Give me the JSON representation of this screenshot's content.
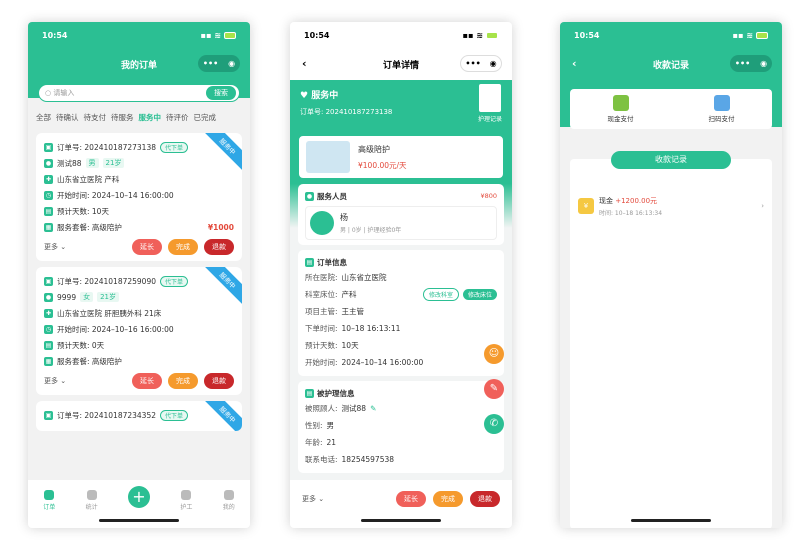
{
  "status_time": "10:54",
  "phone1": {
    "title": "我的订单",
    "search_placeholder": "请输入",
    "search_btn": "搜索",
    "tabs": [
      "全部",
      "待确认",
      "待支付",
      "待服务",
      "服务中",
      "待评价",
      "已完成"
    ],
    "orders": [
      {
        "no": "订单号: 202410187273138",
        "tag": "代下单",
        "ribbon": "服务中",
        "name": "测试88",
        "gender": "男",
        "age": "21岁",
        "hospital": "山东省立医院 产科",
        "start": "开始时间: 2024–10–14 16:00:00",
        "days": "预计天数: 10天",
        "pkg": "服务套餐: 高级陪护",
        "price": "¥1000"
      },
      {
        "no": "订单号: 202410187259090",
        "tag": "代下单",
        "ribbon": "服务中",
        "name": "9999",
        "gender": "女",
        "age": "21岁",
        "hospital": "山东省立医院 肝胆胰外科 21床",
        "start": "开始时间: 2024–10–16 16:00:00",
        "days": "预计天数: 0天",
        "pkg": "服务套餐: 高级陪护",
        "price": ""
      },
      {
        "no": "订单号: 202410187234352",
        "tag": "代下单",
        "ribbon": "服务中"
      }
    ],
    "more": "更多",
    "btn_extend": "延长",
    "btn_done": "完成",
    "btn_refund": "退款",
    "tabbar": [
      "订单",
      "统计",
      "",
      "护工",
      "我的"
    ]
  },
  "phone2": {
    "title": "订单详情",
    "state": "服务中",
    "order_no": "订单号: 202410187273138",
    "care_record": "护理记录",
    "service_name": "高级陪护",
    "service_price": "¥100.00元/天",
    "staff_title": "服务人员",
    "staff_price": "¥800",
    "staff_name": "杨",
    "staff_info": "男 | 0岁 | 护理经验0年",
    "order_info_title": "订单信息",
    "info": [
      {
        "k": "所在医院:",
        "v": "山东省立医院"
      },
      {
        "k": "科室床位:",
        "v": "产科"
      },
      {
        "k": "项目主管:",
        "v": "王主管"
      },
      {
        "k": "下单时间:",
        "v": "10–18 16:13:11"
      },
      {
        "k": "预计天数:",
        "v": "10天"
      },
      {
        "k": "开始时间:",
        "v": "2024–10–14 16:00:00"
      }
    ],
    "edit_dept": "修改科室",
    "edit_bed": "修改床位",
    "patient_title": "被护理信息",
    "patient": [
      {
        "k": "被照顾人:",
        "v": "测试88"
      },
      {
        "k": "性别:",
        "v": "男"
      },
      {
        "k": "年龄:",
        "v": "21"
      },
      {
        "k": "联系电话:",
        "v": "18254597538"
      }
    ],
    "more": "更多",
    "btn_extend": "延长",
    "btn_done": "完成",
    "btn_refund": "退款"
  },
  "phone3": {
    "title": "收款记录",
    "cash": "现金支付",
    "scan": "扫码支付",
    "records_title": "收款记录",
    "item_label": "现金",
    "item_amount": "+1200.00元",
    "item_time": "时间: 10–18 16:13:34"
  },
  "colors": {
    "primary": "#2bbf93",
    "red": "#f0605a",
    "orange": "#f59a2d",
    "dark_red": "#c8282b",
    "ribbon": "#2fa7e6"
  }
}
